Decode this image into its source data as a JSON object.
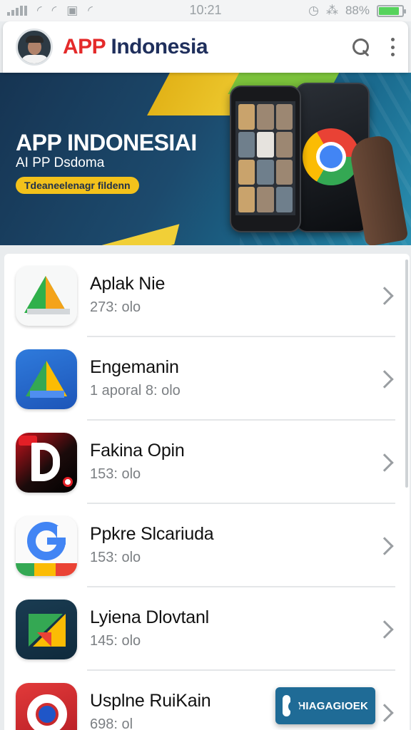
{
  "status_bar": {
    "time": "10:21",
    "battery": "88%",
    "battery_fraction": 0.88
  },
  "header": {
    "title_accent": "APP",
    "title_rest": " Indonesia",
    "icons": [
      "avatar",
      "search-icon",
      "more-vert-icon"
    ]
  },
  "banner": {
    "title": "APP INDONESIAI",
    "subtitle": "AI PP Dsdoma",
    "cta": "Tdeaneelenagr fildenn"
  },
  "apps": [
    {
      "name": "Aplak Nie",
      "meta": "273: olo",
      "icon": "triangle-app-icon"
    },
    {
      "name": "Engemanin",
      "meta": "1 aporal 8: olo",
      "icon": "drive-style-icon"
    },
    {
      "name": "Fakina Opin",
      "meta": "153: olo",
      "icon": "d-letter-icon"
    },
    {
      "name": "Ppkre Slcariuda",
      "meta": "153: olo",
      "icon": "g-logo-icon"
    },
    {
      "name": "Lyiena Dlovtanl",
      "meta": "145: olo",
      "icon": "folded-triangle-icon"
    },
    {
      "name": "Usplne RuiKain",
      "meta": "698: ol",
      "icon": "ring-logo-icon"
    }
  ],
  "floating_button": {
    "label": "HIAGAGIOEK"
  },
  "colors": {
    "title_accent": "#e42a2a",
    "title_main": "#1f2f5c",
    "banner_cta": "#f3c21b",
    "float_button": "#1f6b96"
  }
}
